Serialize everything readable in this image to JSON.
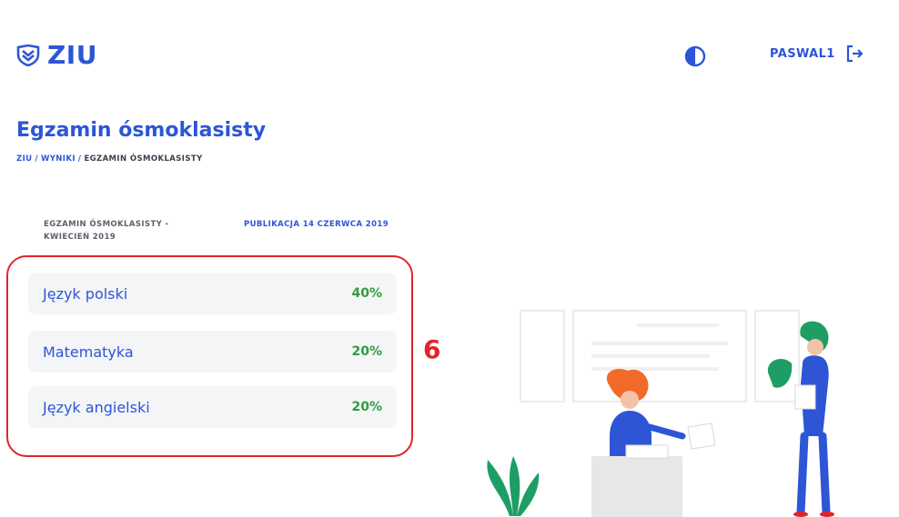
{
  "header": {
    "logo_text": "ZIU",
    "username": "PASWAL1",
    "icons": [
      "ziu-logo-icon",
      "contrast-icon",
      "logout-icon"
    ]
  },
  "page": {
    "title": "Egzamin ósmoklasisty",
    "breadcrumb": {
      "item1": "ZIU",
      "item2": "WYNIKI",
      "item3": "EGZAMIN ÓSMOKLASISTY",
      "sep": "/"
    }
  },
  "exam": {
    "name": "EGZAMIN ÓSMOKLASISTY - KWIECIEŃ 2019",
    "publication": "PUBLIKACJA 14 CZERWCA 2019"
  },
  "results": [
    {
      "subject": "Język polski",
      "score": "40%"
    },
    {
      "subject": "Matematyka",
      "score": "20%"
    },
    {
      "subject": "Język angielski",
      "score": "20%"
    }
  ],
  "annotation": {
    "label": "6",
    "color": "#e0252a"
  },
  "colors": {
    "accent": "#2d55d6",
    "score": "#2e9e3e",
    "highlight": "#e0252a"
  }
}
